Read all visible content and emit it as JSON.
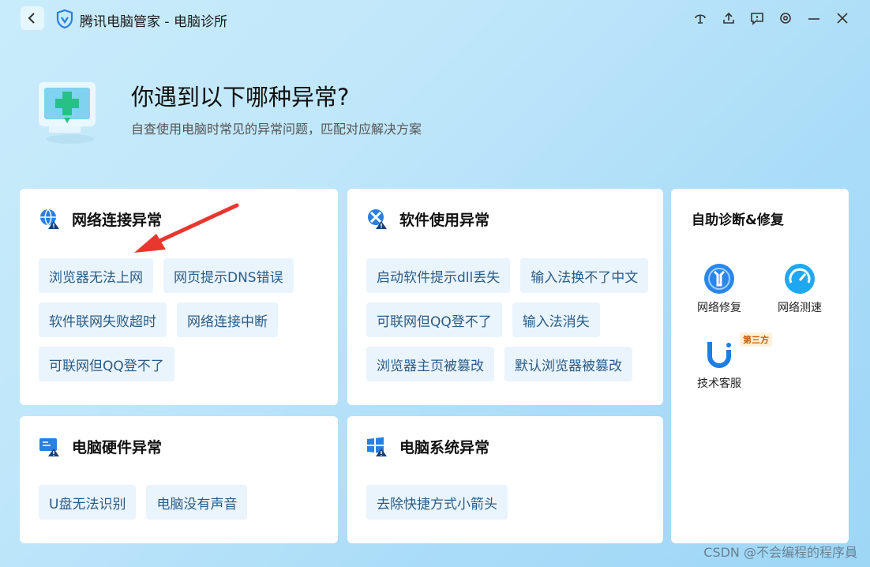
{
  "titlebar": {
    "title": "腾讯电脑管家 - 电脑诊所",
    "controls": [
      "skin-icon",
      "share-icon",
      "feedback-icon",
      "settings-icon",
      "minimize-icon",
      "close-icon"
    ]
  },
  "header": {
    "title": "你遇到以下哪种异常?",
    "subtitle": "自查使用电脑时常见的异常问题，匹配对应解决方案"
  },
  "cards": {
    "network": {
      "title": "网络连接异常",
      "items": [
        "浏览器无法上网",
        "网页提示DNS错误",
        "软件联网失败超时",
        "网络连接中断",
        "可联网但QQ登不了"
      ]
    },
    "software": {
      "title": "软件使用异常",
      "items": [
        "启动软件提示dll丢失",
        "输入法换不了中文",
        "可联网但QQ登不了",
        "输入法消失",
        "浏览器主页被篡改",
        "默认浏览器被篡改"
      ]
    },
    "hardware": {
      "title": "电脑硬件异常",
      "items": [
        "U盘无法识别",
        "电脑没有声音"
      ]
    },
    "system": {
      "title": "电脑系统异常",
      "items": [
        "去除快捷方式小箭头"
      ]
    }
  },
  "sidebar": {
    "title": "自助诊断&修复",
    "tools": [
      {
        "label": "网络修复",
        "icon": "network-repair-icon"
      },
      {
        "label": "网络测速",
        "icon": "speedometer-icon"
      },
      {
        "label": "技术客服",
        "icon": "support-icon",
        "badge": "第三方"
      }
    ]
  },
  "watermark": "CSDN @不会编程的程序員",
  "colors": {
    "accent": "#2a7fe0",
    "chip_bg": "#eaf4fd",
    "chip_text": "#2a5c86",
    "annotation": "#e8372f"
  }
}
